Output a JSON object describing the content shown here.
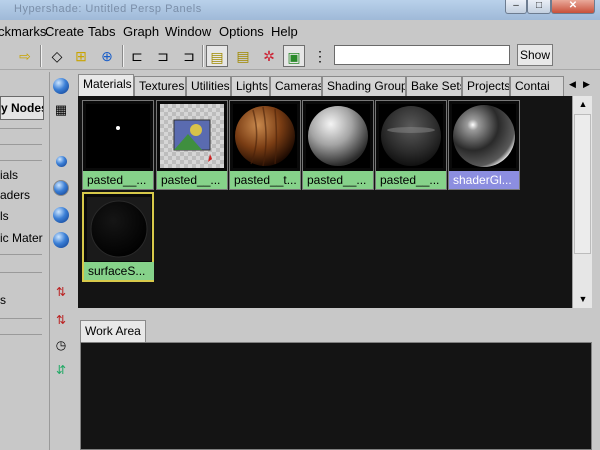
{
  "window": {
    "title": "Hypershade: Untitled  Persp Panels",
    "controls": {
      "minimize": "–",
      "maximize": "□",
      "close": "✕"
    }
  },
  "menu": [
    "ckmarks",
    "Create",
    "Tabs",
    "Graph",
    "Window",
    "Options",
    "Help"
  ],
  "toolbar": {
    "icons": [
      "arrow-right-icon",
      "eraser-icon",
      "graph-nodes-icon",
      "graph-network-icon",
      "input-connections-icon",
      "input-output-icon",
      "output-connections-icon",
      "top-tabs-icon",
      "bottom-tabs-icon",
      "clear-graph-icon",
      "rearrange-graph-icon",
      "toggle-view-icon"
    ],
    "search_value": "",
    "show_button": "Show"
  },
  "left_panel": {
    "tree_button": "y Nodes",
    "items": [
      "ials",
      "aders",
      "ls",
      "ic Mater",
      "s"
    ]
  },
  "tabs": [
    "Materials",
    "Textures",
    "Utilities",
    "Lights",
    "Cameras",
    "Shading Groups",
    "Bake Sets",
    "Projects",
    "Contai"
  ],
  "active_tab": "Materials",
  "swatches": [
    {
      "name": "pasted__...",
      "type": "dot"
    },
    {
      "name": "pasted__...",
      "type": "texture"
    },
    {
      "name": "pasted__t...",
      "type": "wood"
    },
    {
      "name": "pasted__...",
      "type": "grey"
    },
    {
      "name": "pasted__...",
      "type": "dark"
    },
    {
      "name": "shaderGl...",
      "type": "glossy",
      "selected": true
    },
    {
      "name": "surfaceS...",
      "type": "black",
      "highlighted": true
    }
  ],
  "work_area": {
    "tab_label": "Work Area"
  }
}
